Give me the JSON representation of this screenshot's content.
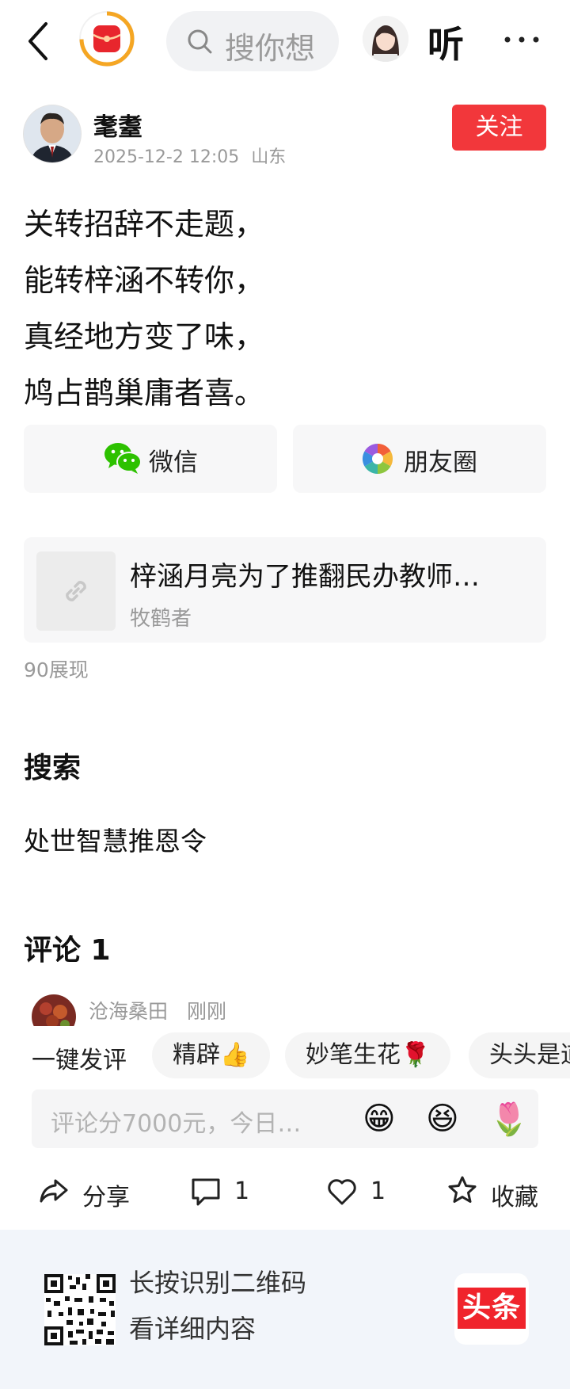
{
  "topbar": {
    "search_placeholder": "搜你想",
    "listen_label": "听"
  },
  "post": {
    "author_name": "耄耋",
    "datetime": "2025-12-2 12:05",
    "location": "山东",
    "follow_label": "关注",
    "lines": [
      "关转招辞不走题，",
      "能转梓涵不转你，",
      "真经地方变了味，",
      "鸠占鹊巢庸者喜。"
    ]
  },
  "share": {
    "wechat_label": "微信",
    "moments_label": "朋友圈"
  },
  "link_card": {
    "title": "梓涵月亮为了推翻民办教师…",
    "source": "牧鹤者"
  },
  "views": "90展现",
  "search_section": {
    "heading": "搜索",
    "term": "处世智慧推恩令"
  },
  "comments": {
    "heading": "评论 1",
    "first_user": "沧海桑田",
    "first_time": "刚刚"
  },
  "quick_comment": {
    "label": "一键发评",
    "chips": [
      "精辟👍",
      "妙笔生花🌹",
      "头头是道"
    ]
  },
  "input": {
    "placeholder": "评论分7000元，今日…",
    "emojis": [
      "😁",
      "😆",
      "🌷"
    ]
  },
  "actions": {
    "share_label": "分享",
    "comment_count": "1",
    "like_count": "1",
    "collect_label": "收藏"
  },
  "footer": {
    "line1": "长按识别二维码",
    "line2": "看详细内容",
    "brand": "头条"
  },
  "colors": {
    "accent_red": "#f2373b",
    "muted_text": "#999999",
    "card_bg": "#f7f7f8",
    "footer_bg": "#f2f5fa"
  }
}
